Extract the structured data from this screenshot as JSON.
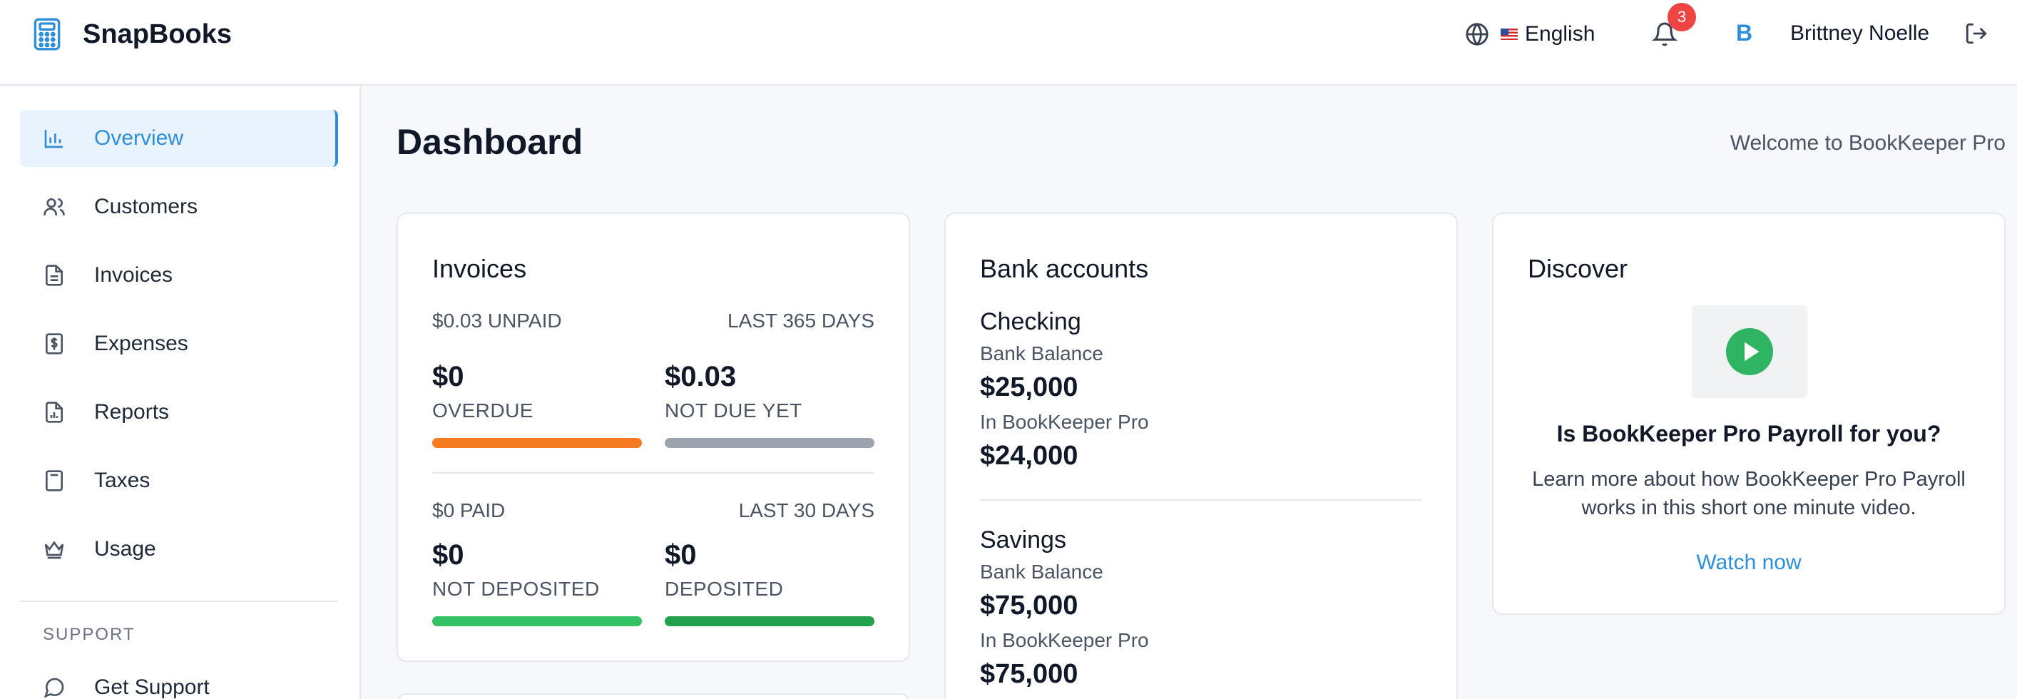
{
  "header": {
    "app_name": "SnapBooks",
    "language": "English",
    "notification_count": "3",
    "user_initial": "B",
    "user_name": "Brittney Noelle"
  },
  "sidebar": {
    "items": [
      {
        "label": "Overview",
        "icon": "bar-chart-icon"
      },
      {
        "label": "Customers",
        "icon": "users-icon"
      },
      {
        "label": "Invoices",
        "icon": "document-icon"
      },
      {
        "label": "Expenses",
        "icon": "dollar-receipt-icon"
      },
      {
        "label": "Reports",
        "icon": "report-icon"
      },
      {
        "label": "Taxes",
        "icon": "calculator-icon"
      },
      {
        "label": "Usage",
        "icon": "crown-icon"
      }
    ],
    "section_title": "SUPPORT",
    "support_items": [
      {
        "label": "Get Support",
        "icon": "chat-icon"
      }
    ]
  },
  "main": {
    "title": "Dashboard",
    "welcome": "Welcome to BookKeeper Pro"
  },
  "invoices": {
    "title": "Invoices",
    "unpaid_summary": "$0.03 UNPAID",
    "unpaid_period": "LAST 365 DAYS",
    "overdue_amount": "$0",
    "overdue_label": "OVERDUE",
    "not_due_amount": "$0.03",
    "not_due_label": "NOT DUE YET",
    "paid_summary": "$0 PAID",
    "paid_period": "LAST 30 DAYS",
    "not_deposited_amount": "$0",
    "not_deposited_label": "NOT DEPOSITED",
    "deposited_amount": "$0",
    "deposited_label": "DEPOSITED",
    "colors": {
      "overdue": "#f47b20",
      "not_due": "#9ca3af",
      "not_deposited": "#34c267",
      "deposited": "#23a04c"
    }
  },
  "bank": {
    "title": "Bank accounts",
    "accounts": [
      {
        "name": "Checking",
        "bank_label": "Bank Balance",
        "bank_balance": "$25,000",
        "app_label": "In BookKeeper Pro",
        "app_balance": "$24,000"
      },
      {
        "name": "Savings",
        "bank_label": "Bank Balance",
        "bank_balance": "$75,000",
        "app_label": "In BookKeeper Pro",
        "app_balance": "$75,000"
      }
    ]
  },
  "discover": {
    "title": "Discover",
    "question": "Is BookKeeper Pro Payroll for you?",
    "description": "Learn more about how BookKeeper Pro Payroll works in this short one minute video.",
    "cta": "Watch now",
    "play_color": "#2fb463"
  }
}
